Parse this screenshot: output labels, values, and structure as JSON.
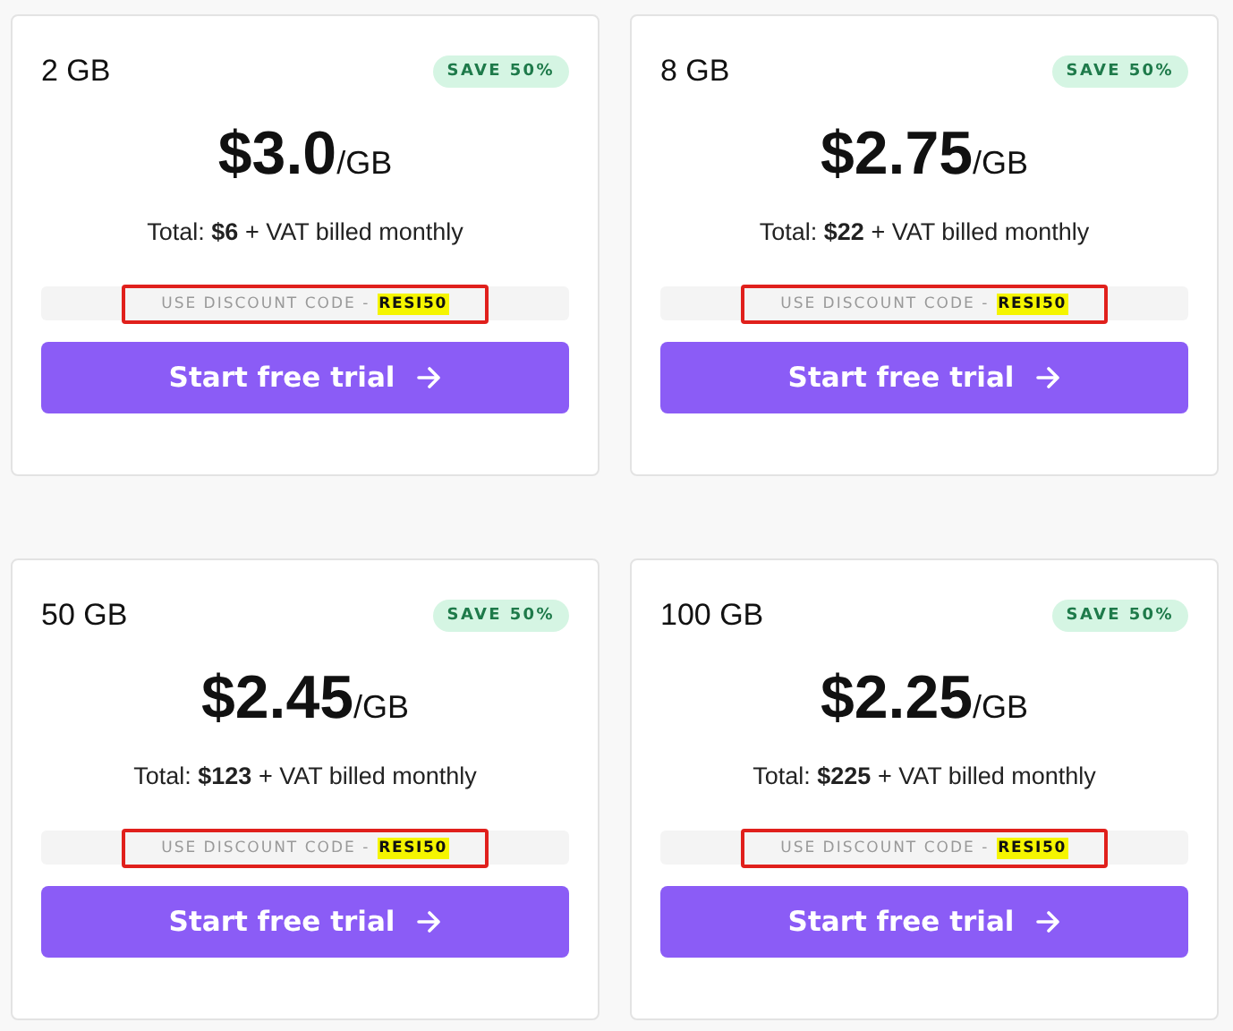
{
  "plans": [
    {
      "size": "2 GB",
      "badge": "SAVE 50%",
      "price": "$3.0",
      "unit": "/GB",
      "total": "Total: **$6** + VAT billed monthly",
      "discount_label": "USE DISCOUNT CODE -",
      "discount_code": "RESI50",
      "highlighted": true,
      "button": "Start free trial"
    },
    {
      "size": "8 GB",
      "badge": "SAVE 50%",
      "price": "$2.75",
      "unit": "/GB",
      "total": "Total: **$22** + VAT billed monthly",
      "discount_label": "USE DISCOUNT CODE -",
      "discount_code": "RESI50",
      "highlighted": true,
      "button": "Start free trial"
    },
    {
      "size": "50 GB",
      "badge": "SAVE 50%",
      "price": "$2.45",
      "unit": "/GB",
      "total": "Total: **$123** + VAT billed monthly",
      "discount_label": "USE DISCOUNT CODE -",
      "discount_code": "RESI50",
      "highlighted": true,
      "button": "Start free trial"
    },
    {
      "size": "100 GB",
      "badge": "SAVE 50%",
      "price": "$2.25",
      "unit": "/GB",
      "total": "Total: **$225** + VAT billed monthly",
      "discount_label": "USE DISCOUNT CODE -",
      "discount_code": "RESI50",
      "highlighted": true,
      "button": "Start free trial"
    }
  ]
}
